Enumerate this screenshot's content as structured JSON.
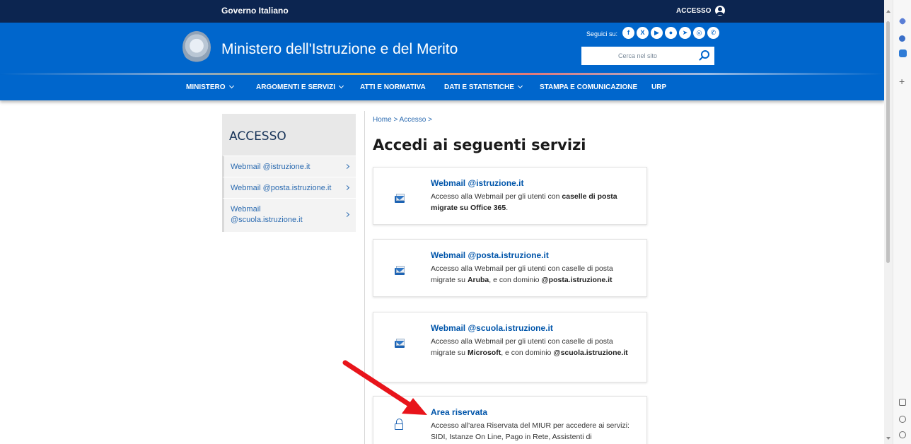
{
  "top_bar": {
    "title": "Governo Italiano",
    "login_label": "ACCESSO"
  },
  "header": {
    "site_title": "Ministero dell'Istruzione e del Merito",
    "social_label": "Seguici su:",
    "social_icons": [
      "facebook-icon",
      "x-icon",
      "youtube-icon",
      "medium-icon",
      "telegram-icon",
      "instagram-icon",
      "whatsapp-icon"
    ],
    "search_placeholder": "Cerca nel sito"
  },
  "nav": {
    "items": [
      {
        "label": "MINISTERO",
        "dropdown": true
      },
      {
        "label": "ARGOMENTI E SERVIZI",
        "dropdown": true
      },
      {
        "label": "ATTI E NORMATIVA",
        "dropdown": false
      },
      {
        "label": "DATI E STATISTICHE",
        "dropdown": true
      },
      {
        "label": "STAMPA E COMUNICAZIONE",
        "dropdown": false
      },
      {
        "label": "URP",
        "dropdown": false
      }
    ]
  },
  "sidebar": {
    "title": "ACCESSO",
    "items": [
      {
        "label": "Webmail @istruzione.it"
      },
      {
        "label": "Webmail @posta.istruzione.it"
      },
      {
        "label": "Webmail @scuola.istruzione.it"
      }
    ]
  },
  "main": {
    "breadcrumb": "Home > Accesso >",
    "page_title": "Accedi ai seguenti servizi",
    "cards": [
      {
        "icon": "mail-icon",
        "title": "Webmail @istruzione.it",
        "desc_1": "Accesso alla Webmail per gli utenti con ",
        "desc_bold_1": "caselle di posta migrate su Office 365",
        "desc_2": "."
      },
      {
        "icon": "mail-icon",
        "title": "Webmail @posta.istruzione.it",
        "desc_1": "Accesso alla Webmail per gli utenti con caselle di posta migrate su ",
        "desc_bold_1": "Aruba",
        "desc_2": ", e con dominio ",
        "desc_bold_2": "@posta.istruzione.it"
      },
      {
        "icon": "mail-icon",
        "title": "Webmail @scuola.istruzione.it",
        "desc_1": "Accesso alla Webmail per gli utenti con caselle di posta migrate su ",
        "desc_bold_1": "Microsoft",
        "desc_2": ", e con dominio ",
        "desc_bold_2": "@scuola.istruzione.it"
      },
      {
        "icon": "lock-icon",
        "title": "Area riservata",
        "desc_1": "Accesso all'area Riservata del MIUR per accedere ai servizi: SIDI, Istanze On Line, Pago in Rete, Assistenti di"
      }
    ]
  },
  "colors": {
    "gov_bar": "#0c2550",
    "brand_blue": "#0066cc",
    "link_blue": "#2a6ab0",
    "annotation_red": "#e8141b"
  }
}
